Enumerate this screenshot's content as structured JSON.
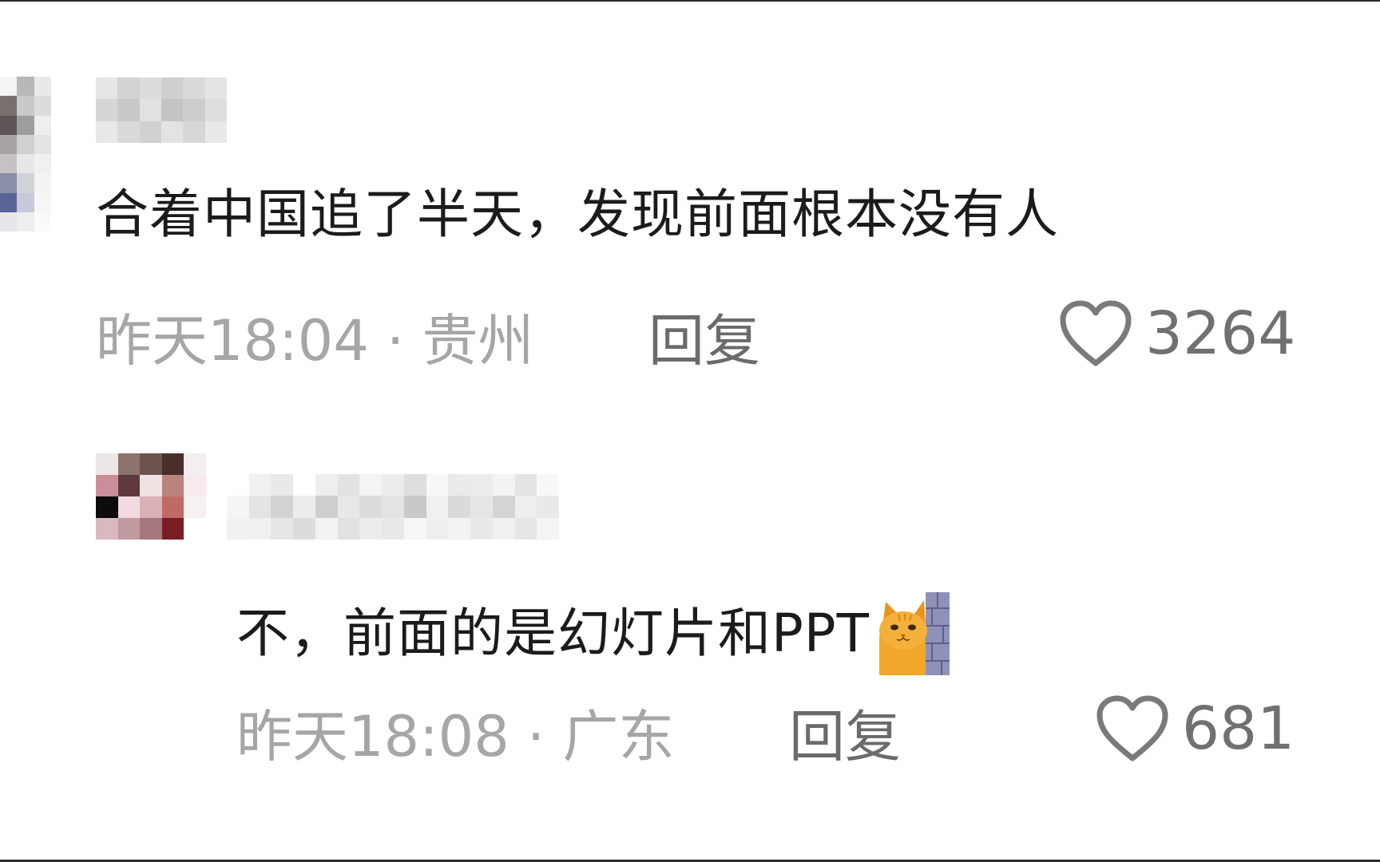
{
  "comments": [
    {
      "text": "合着中国追了半天，发现前面根本没有人",
      "time": "昨天18:04 · 贵州",
      "reply_label": "回复",
      "likes": "3264",
      "avatar_colors": [
        "#f4f4f4",
        "#b8b8b8",
        "#e9e9e9",
        "#7a7070",
        "#c9c9c9",
        "#dcdcdc",
        "#5e5656",
        "#9d9d9d",
        "#eeeeee",
        "#a9a3a3",
        "#d0d0d0",
        "#e3e3e3",
        "#c6c2c4",
        "#e7e7e7",
        "#f0f0f0",
        "#8a8ea8",
        "#d2d3da",
        "#f3f3f3",
        "#5a6396",
        "#c7c9d8",
        "#f6f6f6",
        "#e6e6ea",
        "#eeeeee",
        "#fafafa"
      ],
      "username_colors": [
        "#e6e6e6",
        "#d3d3d3",
        "#dcdcdc",
        "#cfcfcf",
        "#d9d9d9",
        "#e4e4e4",
        "#d6d6d6",
        "#c9c9c9",
        "#e1e1e1",
        "#c4c4c4",
        "#cdcdcd",
        "#dedede",
        "#e8e8e8",
        "#dadada",
        "#d1d1d1",
        "#e3e3e3",
        "#d7d7d7",
        "#e9e9e9"
      ]
    },
    {
      "text": "不，前面的是幻灯片和PPT",
      "emoji": "cat-peeking-emoji",
      "time": "昨天18:08 · 广东",
      "reply_label": "回复",
      "likes": "681",
      "avatar_colors": [
        "#ece6e6",
        "#8b746c",
        "#6d5350",
        "#4a2e2c",
        "#f5eeee",
        "#c98e98",
        "#5e3a3e",
        "#efe2e2",
        "#b9847b",
        "#f7e9ec",
        "#0c0c0c",
        "#f2dbe0",
        "#d9b0b4",
        "#c06a66",
        "#f8f0f0",
        "#dbb8c0",
        "#bf9aa0",
        "#a4787c",
        "#7a1c24",
        "#ffffff"
      ],
      "username_colors": [
        "#ffffff",
        "#f1f1f1",
        "#e9e9e9",
        "#ffffff",
        "#eeeeee",
        "#e2e2e2",
        "#f4f4f4",
        "#ececec",
        "#dedede",
        "#f7f7f7",
        "#eaeaea",
        "#ececec",
        "#f3f3f3",
        "#e4e4e4",
        "#f8f8f8",
        "#f5f5f5",
        "#e4e4e4",
        "#d2d2d2",
        "#ececec",
        "#cfcfcf",
        "#e8e8e8",
        "#dcdcdc",
        "#e3e3e3",
        "#c9c9c9",
        "#f0f0f0",
        "#dadada",
        "#e6e6e6",
        "#d4d4d4",
        "#eeeeee",
        "#e9e9e9",
        "#f1f1f1",
        "#f0f0f0",
        "#e6e6e6",
        "#dcdcdc",
        "#f2f2f2",
        "#e1e1e1",
        "#ececec",
        "#e8e8e8",
        "#f6f6f6",
        "#eeeeee",
        "#f3f3f3",
        "#e9e9e9",
        "#f0f0f0",
        "#e6e6e6",
        "#f4f4f4"
      ]
    }
  ],
  "icons": {
    "like": "heart-outline-icon"
  },
  "colors": {
    "meta_text": "#a6a6a6",
    "reply_text": "#6b6b6b",
    "like_count": "#707070",
    "body_text": "#1b1b1b"
  }
}
